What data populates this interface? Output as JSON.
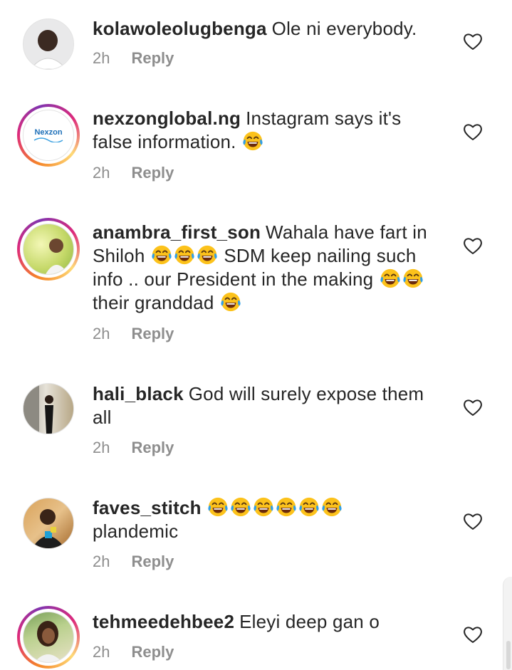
{
  "comments": [
    {
      "username": "kolawoleolugbenga",
      "text": "Ole ni everybody.",
      "time": "2h",
      "reply": "Reply",
      "avatar": "man-portrait"
    },
    {
      "username": "nexzonglobal.ng",
      "text": "Instagram says it's false information.",
      "emoji_after": "face-with-tears-of-joy",
      "time": "2h",
      "reply": "Reply",
      "avatar": "nexzon-logo",
      "logo_text": "Nexzon"
    },
    {
      "username": "anambra_first_son",
      "text_part1": "Wahala have fart in Shiloh",
      "text_part2": "SDM keep nailing such info .. our President in the making",
      "text_part3": "their granddad",
      "time": "2h",
      "reply": "Reply",
      "avatar": "man-portrait"
    },
    {
      "username": "hali_black",
      "text": "God will surely expose them all",
      "time": "2h",
      "reply": "Reply",
      "avatar": "person-standing"
    },
    {
      "username": "faves_stitch",
      "text": "plandemic",
      "time": "2h",
      "reply": "Reply",
      "avatar": "man-portrait"
    },
    {
      "username": "tehmeedehbee2",
      "text": "Eleyi deep gan o",
      "time": "2h",
      "reply": "Reply",
      "avatar": "woman-portrait"
    }
  ],
  "icons": {
    "like": "heart-outline-icon",
    "emoji": "face-with-tears-of-joy"
  },
  "colors": {
    "username": "#262626",
    "meta": "#8e8e8e",
    "heart": "#262626",
    "emoji_face": "#fcc21b",
    "tears": "#2f9ee8"
  }
}
